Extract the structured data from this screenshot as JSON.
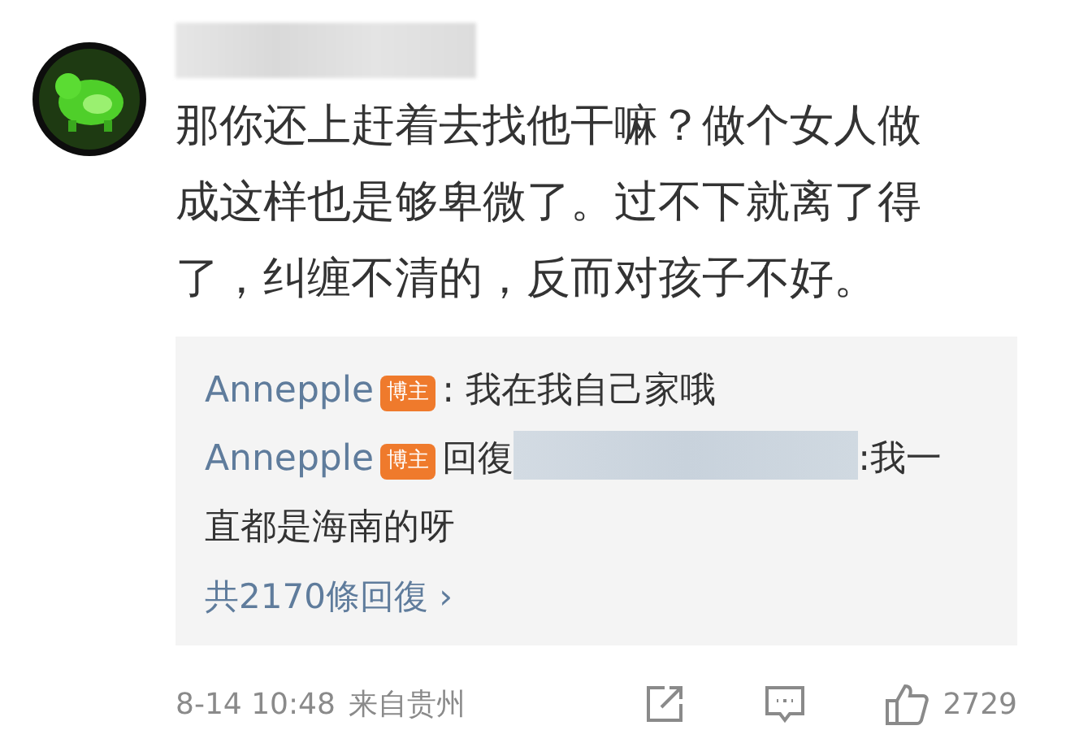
{
  "comment": {
    "text": "那你还上赶着去找他干嘛？做个女人做成这样也是够卑微了。过不下就离了得了，纠缠不清的，反而对孩子不好。",
    "time": "8-14 10:48",
    "source": "来自贵州",
    "like_count": "2729"
  },
  "replies": [
    {
      "kind": "plain",
      "author": "Annepple",
      "badge": "博主",
      "text": ": 我在我自己家哦"
    },
    {
      "kind": "reply_to",
      "author": "Annepple",
      "badge": "博主",
      "prefix": "回復",
      "text": ":我一",
      "continuation": "直都是海南的呀"
    }
  ],
  "more_replies": {
    "label": "共2170條回復",
    "arrow": "›"
  }
}
